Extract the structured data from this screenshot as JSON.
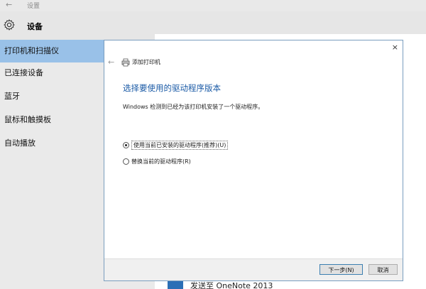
{
  "window": {
    "back_glyph": "←",
    "title": "设置"
  },
  "header": {
    "title": "设备",
    "icon": "gear-icon"
  },
  "sidebar": {
    "items": [
      {
        "label": "打印机和扫描仪",
        "active": true
      },
      {
        "label": "已连接设备",
        "active": false
      },
      {
        "label": "蓝牙",
        "active": false
      },
      {
        "label": "鼠标和触摸板",
        "active": false
      },
      {
        "label": "自动播放",
        "active": false
      }
    ]
  },
  "main": {
    "bottom_item": "发送至 OneNote 2013"
  },
  "dialog": {
    "close_glyph": "×",
    "back_glyph": "←",
    "title": "添加打印机",
    "heading": "选择要使用的驱动程序版本",
    "description": "Windows 检测到已经为该打印机安装了一个驱动程序。",
    "options": [
      {
        "label": "使用当前已安装的驱动程序(推荐)(U)",
        "checked": true
      },
      {
        "label": "替换当前的驱动程序(R)",
        "checked": false
      }
    ],
    "buttons": {
      "next": "下一步(N)",
      "cancel": "取消"
    }
  },
  "colors": {
    "accent": "#1a5aa6",
    "sidebar_active": "#99c1e8",
    "sidebar_bg": "#eaeaea",
    "onenote": "#2b6fb6"
  }
}
